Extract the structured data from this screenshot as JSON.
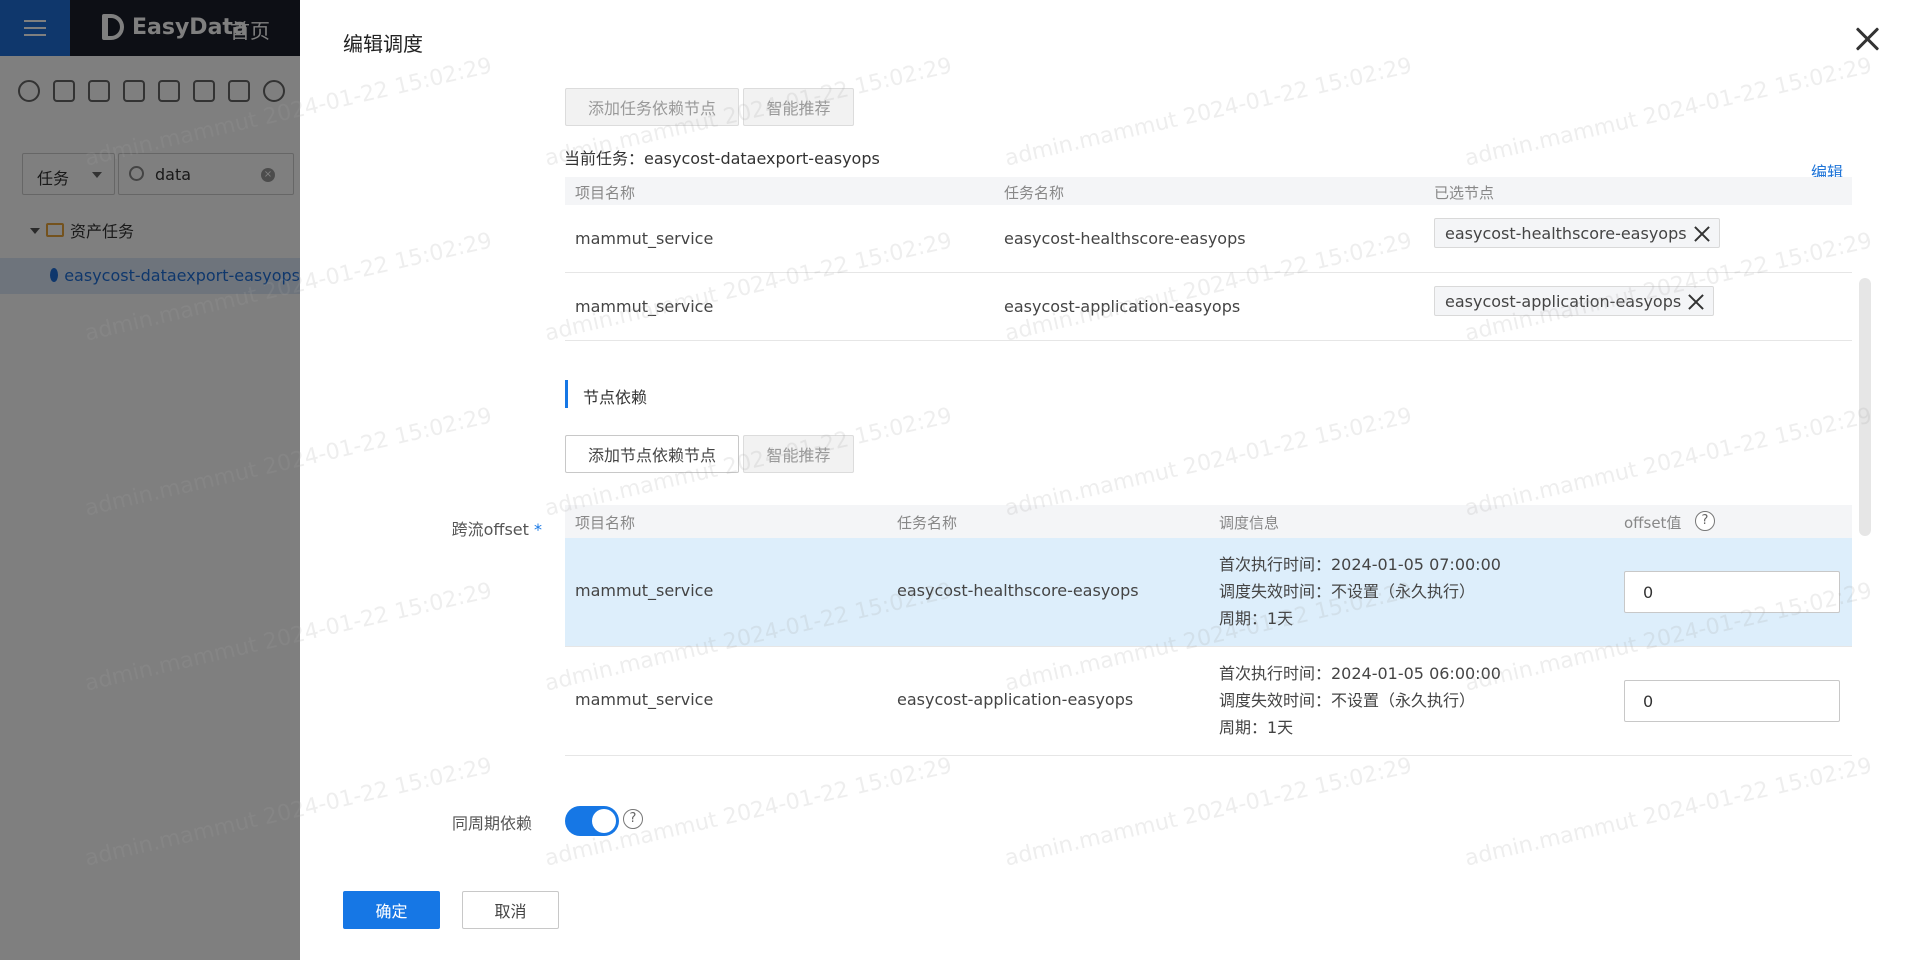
{
  "app": {
    "logo_text": "EasyData",
    "home_label": "首页",
    "filter_select": "任务",
    "search_value": "data",
    "tree_root": "资产任务",
    "tree_child": "easycost-dataexport-easyops"
  },
  "drawer": {
    "title": "编辑调度",
    "buttons": {
      "add_task_dep": "添加任务依赖节点",
      "smart_recommend_1": "智能推荐",
      "add_node_dep": "添加节点依赖节点",
      "smart_recommend_2": "智能推荐",
      "confirm": "确定",
      "cancel": "取消"
    },
    "current_task_label": "当前任务：",
    "current_task_value": "easycost-dataexport-easyops",
    "edit_link": "编辑",
    "task_dep_table": {
      "headers": [
        "项目名称",
        "任务名称",
        "已选节点"
      ],
      "rows": [
        {
          "project": "mammut_service",
          "task": "easycost-healthscore-easyops",
          "node": "easycost-healthscore-easyops"
        },
        {
          "project": "mammut_service",
          "task": "easycost-application-easyops",
          "node": "easycost-application-easyops"
        }
      ]
    },
    "node_dep_section_title": "节点依赖",
    "cross_offset_label": "跨流offset",
    "required_mark": "*",
    "offset_table": {
      "headers": [
        "项目名称",
        "任务名称",
        "调度信息",
        "offset值"
      ],
      "help_glyph": "?",
      "rows": [
        {
          "project": "mammut_service",
          "task": "easycost-healthscore-easyops",
          "first_exec": "首次执行时间：2024-01-05 07:00:00",
          "expire": "调度失效时间：不设置（永久执行）",
          "period": "周期：1天",
          "offset": "0"
        },
        {
          "project": "mammut_service",
          "task": "easycost-application-easyops",
          "first_exec": "首次执行时间：2024-01-05 06:00:00",
          "expire": "调度失效时间：不设置（永久执行）",
          "period": "周期：1天",
          "offset": "0"
        }
      ]
    },
    "same_period_label": "同周期依赖",
    "same_period_enabled": true
  },
  "watermark": "admin.mammut 2024-01-22 15:02:29"
}
